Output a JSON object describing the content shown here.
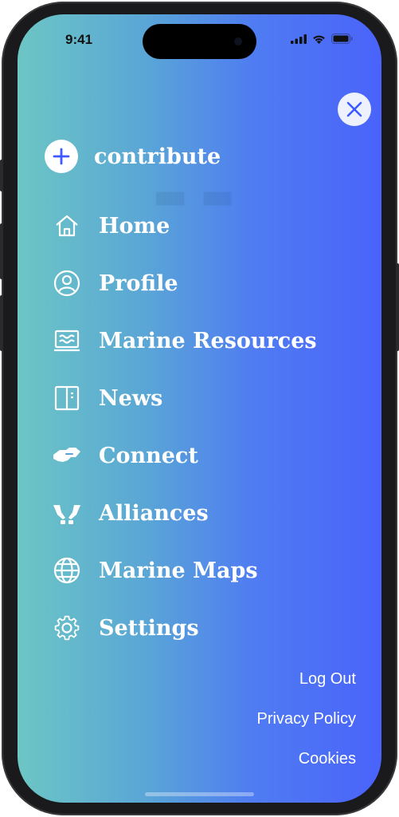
{
  "status_bar": {
    "time": "9:41"
  },
  "menu": {
    "contribute_label": "contribute",
    "items": [
      {
        "label": "Home",
        "icon": "home-icon"
      },
      {
        "label": "Profile",
        "icon": "profile-icon"
      },
      {
        "label": "Marine Resources",
        "icon": "marine-resources-icon"
      },
      {
        "label": "News",
        "icon": "news-icon"
      },
      {
        "label": "Connect",
        "icon": "handshake-icon"
      },
      {
        "label": "Alliances",
        "icon": "alliances-icon"
      },
      {
        "label": "Marine Maps",
        "icon": "globe-icon"
      },
      {
        "label": "Settings",
        "icon": "gear-icon"
      }
    ]
  },
  "footer": {
    "logout": "Log Out",
    "privacy": "Privacy Policy",
    "cookies": "Cookies"
  },
  "colors": {
    "gradient_start": "#6cc6c4",
    "gradient_end": "#4a63fb",
    "accent": "#3d5afe",
    "text": "#ffffff"
  }
}
